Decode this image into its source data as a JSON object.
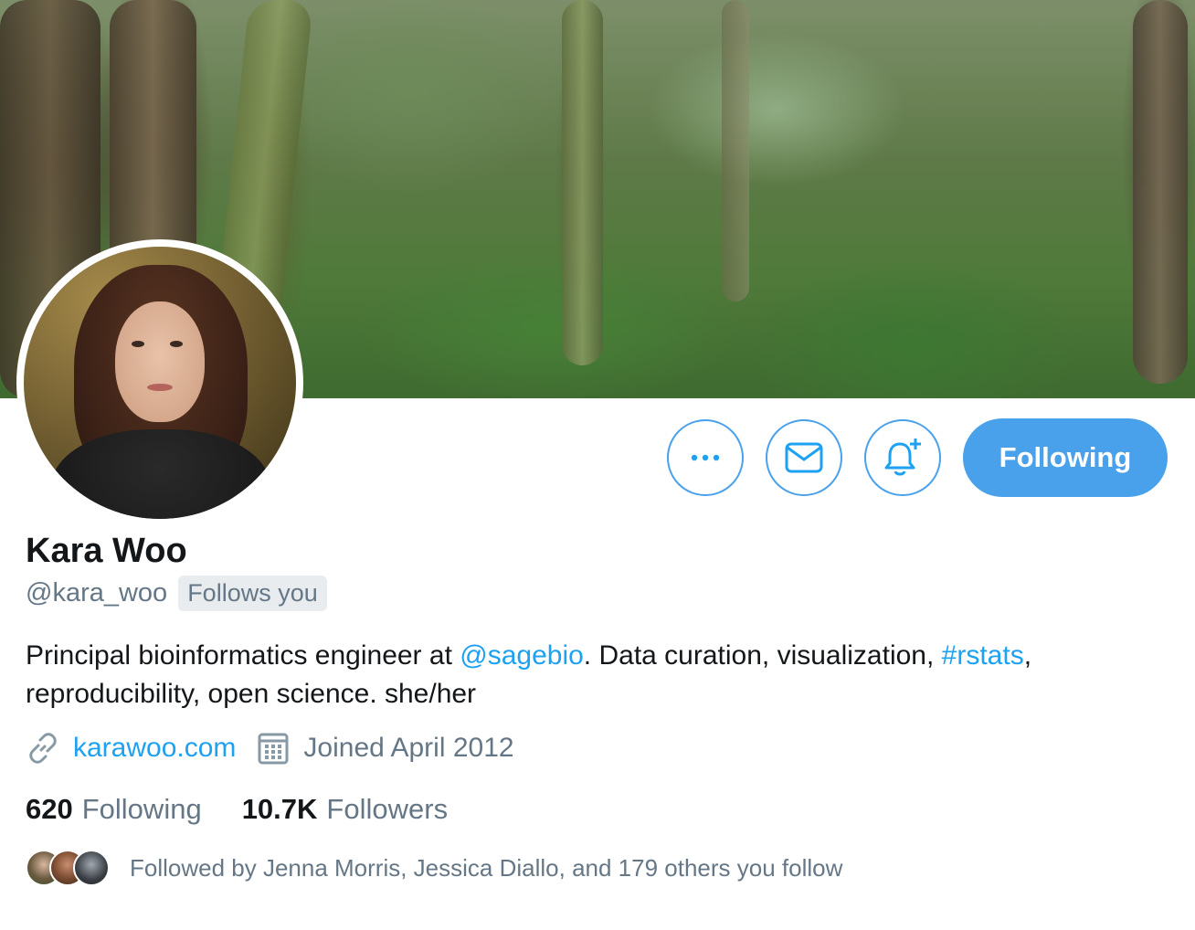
{
  "profile": {
    "display_name": "Kara Woo",
    "handle": "@kara_woo",
    "follows_you_badge": "Follows you",
    "bio": {
      "part1": "Principal bioinformatics engineer at ",
      "mention": "@sagebio",
      "part2": ". Data curation, visualization, ",
      "hashtag": "#rstats",
      "part3": ", reproducibility, open science. she/her"
    },
    "website": "karawoo.com",
    "joined": "Joined April 2012",
    "following_count": "620",
    "following_label": "Following",
    "followers_count": "10.7K",
    "followers_label": "Followers",
    "followed_by": "Followed by Jenna Morris, Jessica Diallo, and 179 others you follow"
  },
  "actions": {
    "more_icon": "more-horizontal-icon",
    "message_icon": "envelope-icon",
    "notify_icon": "bell-plus-icon",
    "follow_button_label": "Following"
  },
  "colors": {
    "accent": "#1da1f2",
    "button_fill": "#4aa1eb",
    "secondary_text": "#657786",
    "primary_text": "#14171a"
  }
}
